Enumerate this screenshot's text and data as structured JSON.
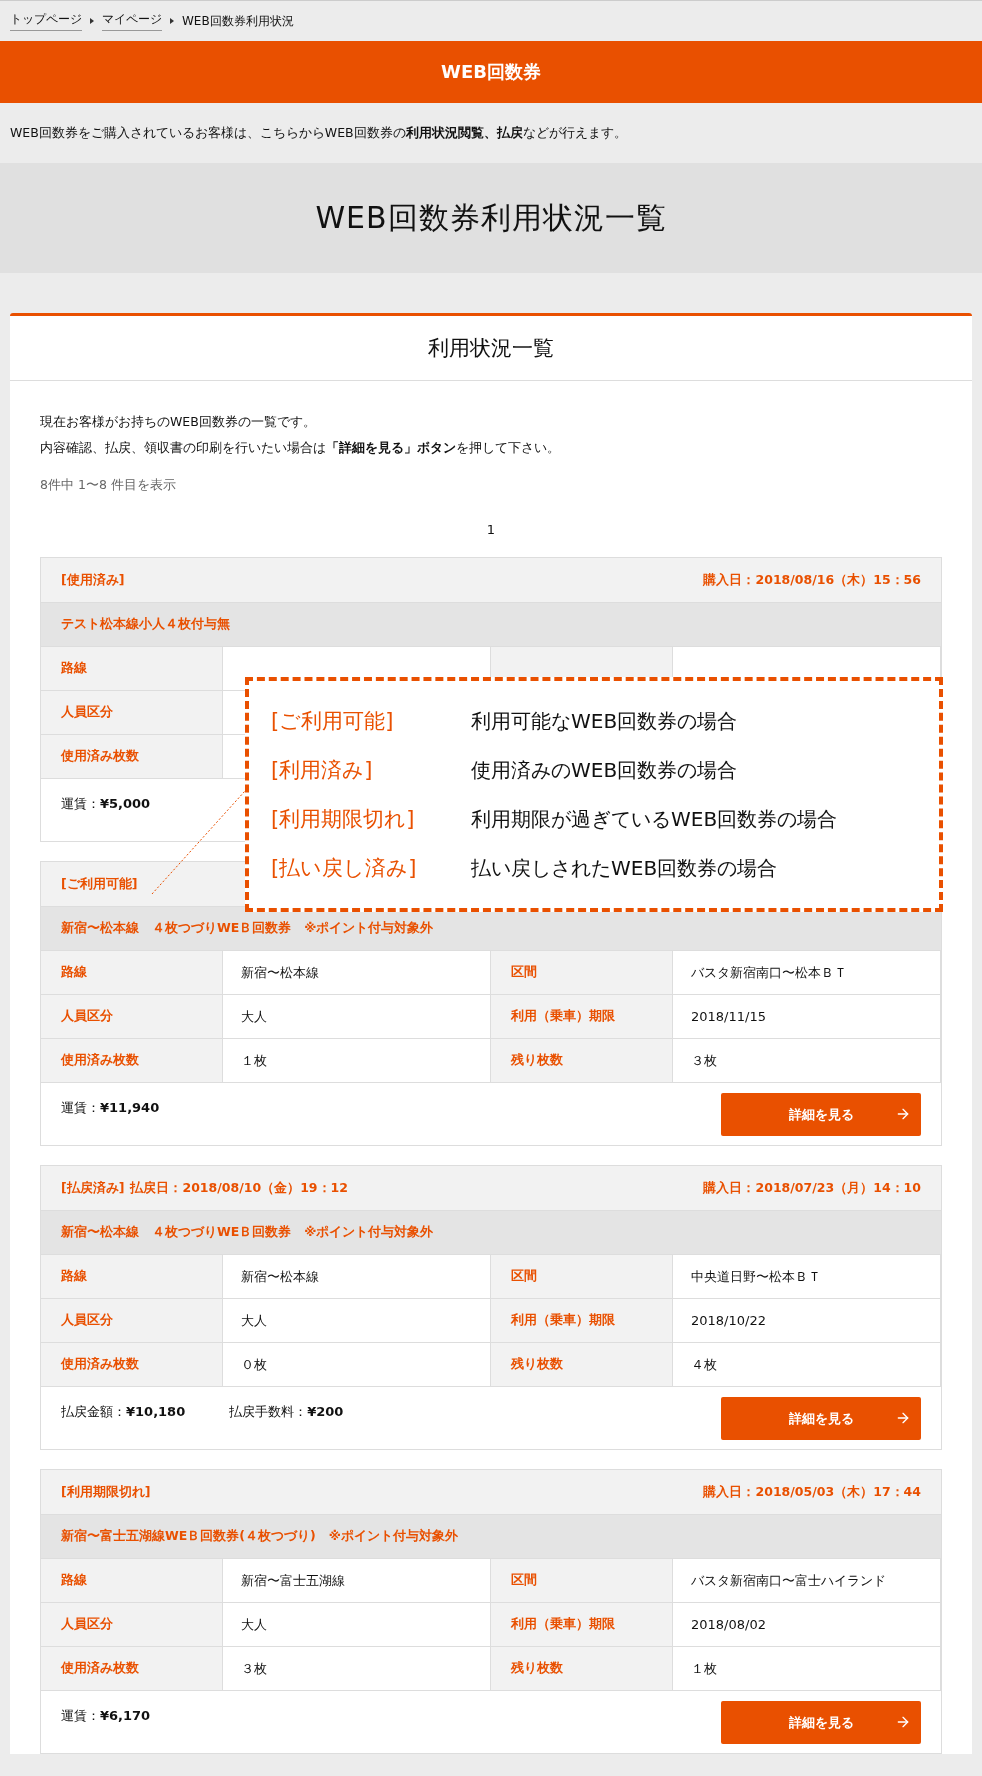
{
  "breadcrumb": [
    {
      "label": "トップページ",
      "link": true
    },
    {
      "label": "マイページ",
      "link": true
    },
    {
      "label": "WEB回数券利用状況",
      "link": false
    }
  ],
  "banner": {
    "title": "WEB回数券"
  },
  "intro": "WEB回数券をご購入されているお客様は、こちらからWEB回数券の**利用状況閲覧、払戻**などが行えます。",
  "page_title": "WEB回数券利用状況一覧",
  "panel": {
    "title": "利用状況一覧",
    "description": [
      "現在お客様がお持ちのWEB回数券の一覧です。",
      "内容確認、払戻、領収書の印刷を行いたい場合は**「詳細を見る」ボタン**を押して下さい。"
    ],
    "count": "8件中 1〜8 件目を表示",
    "pagination": [
      "1"
    ]
  },
  "tickets": [
    {
      "status": "[使用済み]",
      "purchase_date": "購入日：2018/08/16（木）15：56",
      "name": "テスト松本線小人４枚付与無",
      "rows": [
        {
          "label": "路線"
        },
        {
          "label": "人員区分"
        },
        {
          "label": "使用済み枚数"
        }
      ],
      "footer": [
        "運賃：**¥5,000**"
      ]
    },
    {
      "status": "[ご利用可能]",
      "name": "新宿〜松本線　４枚つづりWEＢ回数券　※ポイント付与対象外",
      "rows": [
        {
          "label": "路線",
          "value": "新宿〜松本線",
          "label2": "区間",
          "value2": "バスタ新宿南口〜松本ＢＴ"
        },
        {
          "label": "人員区分",
          "value": "大人",
          "label2": "利用（乗車）期限",
          "value2": "2018/11/15"
        },
        {
          "label": "使用済み枚数",
          "value": "１枚",
          "label2": "残り枚数",
          "value2": "３枚"
        }
      ],
      "footer": [
        "運賃：**¥11,940**"
      ],
      "button": "詳細を見る"
    },
    {
      "status": "[払戻済み]",
      "refund_date": "払戻日：2018/08/10（金）19：12",
      "purchase_date": "購入日：2018/07/23（月）14：10",
      "name": "新宿〜松本線　４枚つづりWEＢ回数券　※ポイント付与対象外",
      "rows": [
        {
          "label": "路線",
          "value": "新宿〜松本線",
          "label2": "区間",
          "value2": "中央道日野〜松本ＢＴ"
        },
        {
          "label": "人員区分",
          "value": "大人",
          "label2": "利用（乗車）期限",
          "value2": "2018/10/22"
        },
        {
          "label": "使用済み枚数",
          "value": "０枚",
          "label2": "残り枚数",
          "value2": "４枚"
        }
      ],
      "footer": [
        "払戻金額：**¥10,180**",
        "払戻手数料：**¥200**"
      ],
      "button": "詳細を見る"
    },
    {
      "status": "[利用期限切れ]",
      "purchase_date": "購入日：2018/05/03（木）17：44",
      "name": "新宿〜富士五湖線WEＢ回数券(４枚つづり)　※ポイント付与対象外",
      "rows": [
        {
          "label": "路線",
          "value": "新宿〜富士五湖線",
          "label2": "区間",
          "value2": "バスタ新宿南口〜富士ハイランド"
        },
        {
          "label": "人員区分",
          "value": "大人",
          "label2": "利用（乗車）期限",
          "value2": "2018/08/02"
        },
        {
          "label": "使用済み枚数",
          "value": "３枚",
          "label2": "残り枚数",
          "value2": "１枚"
        }
      ],
      "footer": [
        "運賃：**¥6,170**"
      ],
      "button": "詳細を見る"
    }
  ],
  "callout": {
    "items": [
      {
        "term": "[ご利用可能]",
        "description": "利用可能なWEB回数券の場合"
      },
      {
        "term": "[利用済み]",
        "description": "使用済みのWEB回数券の場合"
      },
      {
        "term": "[利用期限切れ]",
        "description": "利用期限が過ぎているWEB回数券の場合"
      },
      {
        "term": "[払い戻し済み]",
        "description": "払い戻しされたWEB回数券の場合"
      }
    ]
  }
}
